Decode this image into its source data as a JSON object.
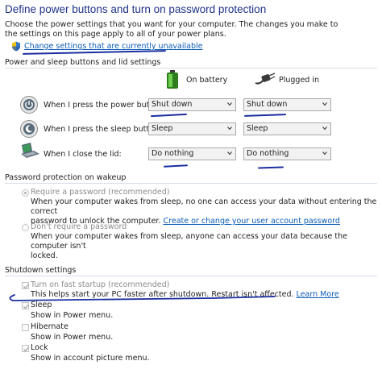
{
  "title": "Define power buttons and turn on password protection",
  "intro": "Choose the power settings that you want for your computer. The changes you make to the settings on this page apply to all of your power plans.",
  "change_link": "Change settings that are currently unavailable",
  "power_section": {
    "heading": "Power and sleep buttons and lid settings",
    "on_battery": "On battery",
    "plugged_in": "Plugged in",
    "rows": [
      {
        "label": "When I press the power button:",
        "battery": "Shut down",
        "plugged": "Shut down"
      },
      {
        "label": "When I press the sleep button:",
        "battery": "Sleep",
        "plugged": "Sleep"
      },
      {
        "label": "When I close the lid:",
        "battery": "Do nothing",
        "plugged": "Do nothing"
      }
    ]
  },
  "password_section": {
    "heading": "Password protection on wakeup",
    "require_label": "Require a password (recommended)",
    "require_desc_1": "When your computer wakes from sleep, no one can access your data without entering the correct",
    "require_desc_2": "password to unlock the computer.",
    "require_link": "Create or change your user account password",
    "dont_label": "Don't require a password",
    "dont_desc_1": "When your computer wakes from sleep, anyone can access your data because the computer isn't",
    "dont_desc_2": "locked."
  },
  "shutdown_section": {
    "heading": "Shutdown settings",
    "fast_label": "Turn on fast startup (recommended)",
    "fast_desc": "This helps start your PC faster after shutdown. Restart isn't affected.",
    "fast_link": "Learn More",
    "sleep_label": "Sleep",
    "sleep_desc": "Show in Power menu.",
    "hibernate_label": "Hibernate",
    "hibernate_desc": "Show in Power menu.",
    "lock_label": "Lock",
    "lock_desc": "Show in account picture menu."
  },
  "colors": {
    "title": "#1e3287",
    "link": "#0b5cb5",
    "annotation_pen": "#1a2fa0"
  }
}
